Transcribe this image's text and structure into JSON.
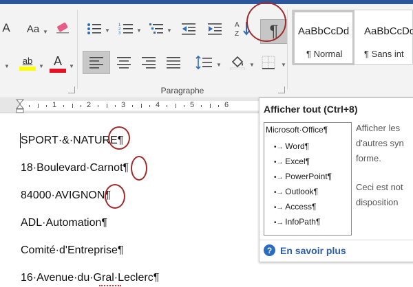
{
  "ribbon": {
    "font_size_label": "A",
    "change_case_label": "Aa",
    "highlight_label": "ab",
    "font_color_label": "A",
    "sort_label": "A Z",
    "show_all_label": "¶",
    "group_label": "Paragraphe",
    "colors": {
      "highlight": "#ffff00",
      "font": "#e81123",
      "accent": "#2b579a",
      "annotation": "#9e2a2b"
    }
  },
  "styles": [
    {
      "sample": "AaBbCcDd",
      "name": "¶ Normal"
    },
    {
      "sample": "AaBbCcDd",
      "name": "¶ Sans int"
    }
  ],
  "ruler": {
    "numbers": [
      "1",
      "2",
      "3",
      "4",
      "5",
      "6"
    ]
  },
  "document": {
    "lines": [
      "SPORT·&·NATURE¶",
      "18·Boulevard·Carnot¶",
      "84000·AVIGNON¶",
      "ADL·Automation¶",
      "Comité·d'Entreprise¶",
      "16·Avenue·du·Gral·Leclerc¶"
    ]
  },
  "tooltip": {
    "title": "Afficher tout (Ctrl+8)",
    "preview": {
      "header": "Microsoft·Office¶",
      "items": [
        "Word¶",
        "Excel¶",
        "PowerPoint¶",
        "Outlook¶",
        "Access¶",
        "InfoPath¶"
      ]
    },
    "description": [
      "Afficher les",
      "d'autres syn",
      "forme."
    ],
    "description2": [
      "Ceci est not",
      "disposition"
    ],
    "help_link": "En savoir plus",
    "help_icon": "?"
  }
}
